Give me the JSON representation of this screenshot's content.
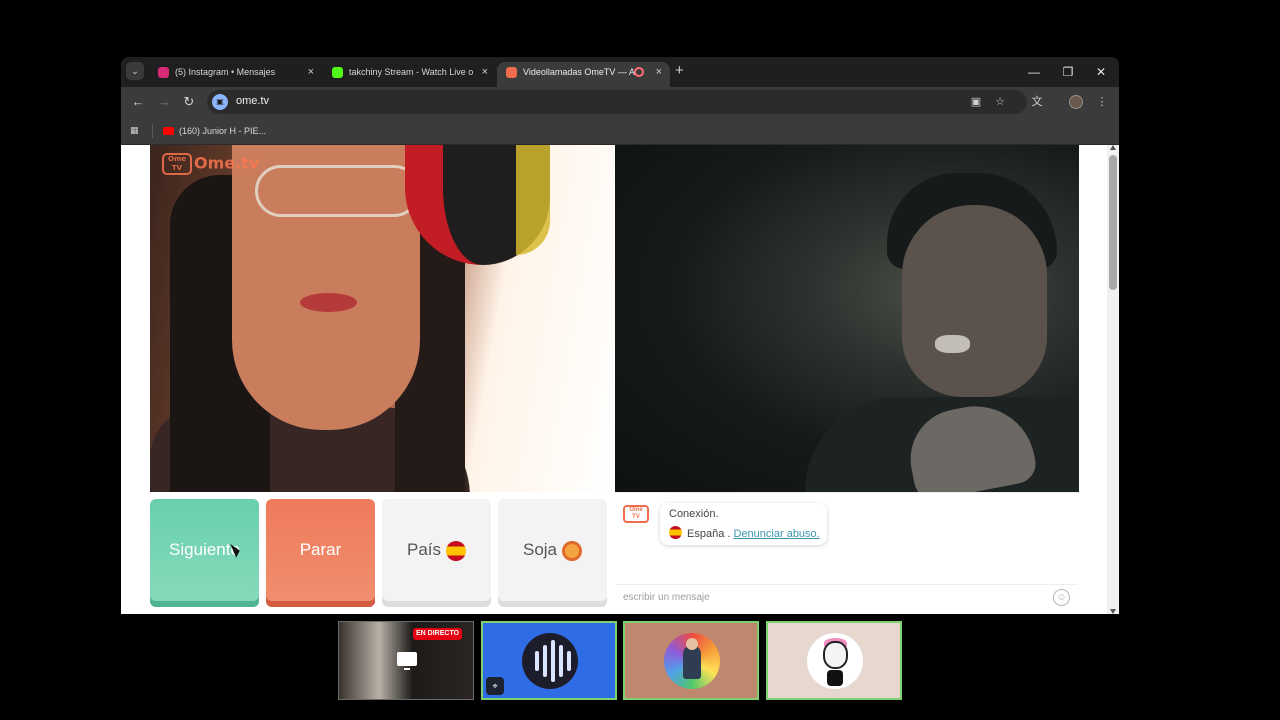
{
  "browser": {
    "tabs": [
      {
        "title": "(5) Instagram • Mensajes",
        "color": "#d62976"
      },
      {
        "title": "takchiny Stream - Watch Live o",
        "color": "#53fc18"
      },
      {
        "title": "Videollamadas OmeTV — A",
        "color": "#ef6d4c"
      }
    ],
    "url": "ome.tv",
    "bookmark": "(160) Junior H - PIE..."
  },
  "page": {
    "watermark": "Ome.tv",
    "buttons": {
      "next": "Siguiente",
      "stop": "Parar",
      "country": "País",
      "gender": "Soja"
    },
    "chat": {
      "connection": "Conexión.",
      "country": "España",
      "separator": ".",
      "report": "Denunciar abuso.",
      "placeholder": "escribir un mensaje"
    }
  },
  "taskbar": {
    "live_badge": "EN DIRECTO"
  },
  "colors": {
    "accent_green": "#69cfad",
    "accent_orange": "#ef7a5c",
    "link": "#3b93ae"
  }
}
